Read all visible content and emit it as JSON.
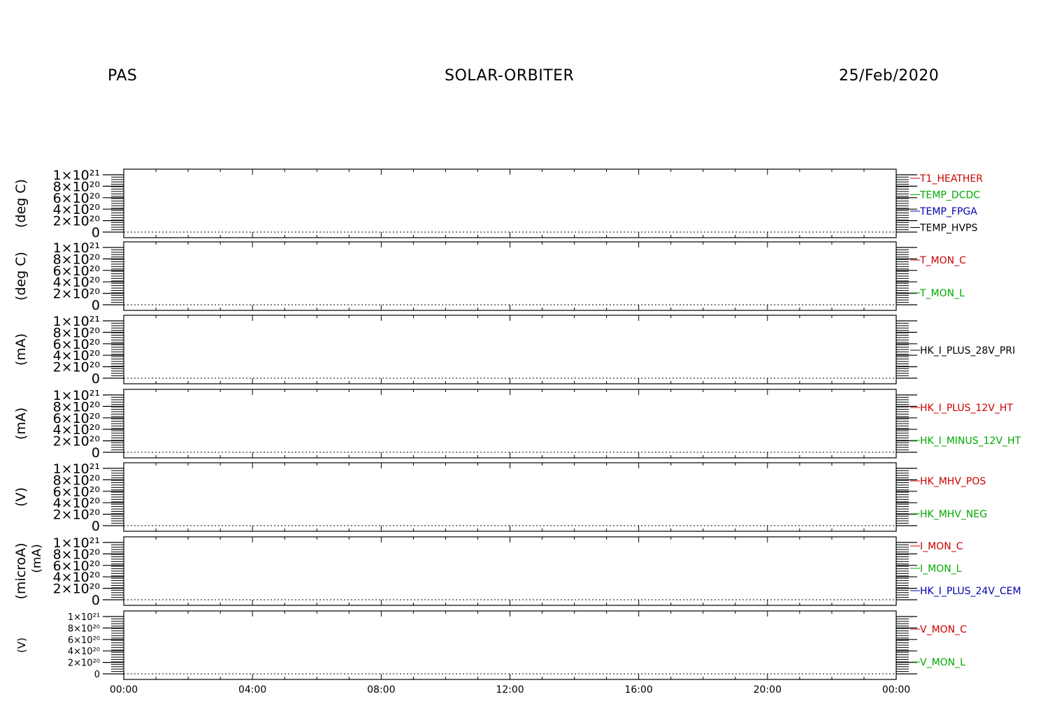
{
  "header": {
    "instrument": "PAS",
    "mission": "SOLAR-ORBITER",
    "date": "25/Feb/2020"
  },
  "colors": {
    "red": "#cc0000",
    "green": "#00aa00",
    "blue": "#0000aa",
    "black": "#000000"
  },
  "chart_data": {
    "type": "line",
    "x_axis": {
      "range": [
        "00:00",
        "24:00"
      ],
      "tick_labels": [
        "00:00",
        "04:00",
        "08:00",
        "12:00",
        "16:00",
        "20:00",
        "00:00"
      ]
    },
    "panels": [
      {
        "ylabel": "(deg C)",
        "ylim": [
          0,
          1e+21
        ],
        "tick_labels": [
          "1×10²¹",
          "8×10²⁰",
          "6×10²⁰",
          "4×10²⁰",
          "2×10²⁰",
          "0"
        ],
        "series": [
          {
            "name": "T1_HEATHER",
            "color": "#cc0000"
          },
          {
            "name": "TEMP_DCDC",
            "color": "#00aa00"
          },
          {
            "name": "TEMP_FPGA",
            "color": "#0000aa"
          },
          {
            "name": "TEMP_HVPS",
            "color": "#000000"
          }
        ]
      },
      {
        "ylabel": "(deg C)",
        "ylim": [
          0,
          1e+21
        ],
        "tick_labels": [
          "1×10²¹",
          "8×10²⁰",
          "6×10²⁰",
          "4×10²⁰",
          "2×10²⁰",
          "0"
        ],
        "series": [
          {
            "name": "T_MON_C",
            "color": "#cc0000"
          },
          {
            "name": "T_MON_L",
            "color": "#00aa00"
          }
        ]
      },
      {
        "ylabel": "(mA)",
        "ylim": [
          0,
          1e+21
        ],
        "tick_labels": [
          "1×10²¹",
          "8×10²⁰",
          "6×10²⁰",
          "4×10²⁰",
          "2×10²⁰",
          "0"
        ],
        "series": [
          {
            "name": "HK_I_PLUS_28V_PRI",
            "color": "#000000"
          }
        ]
      },
      {
        "ylabel": "(mA)",
        "ylim": [
          0,
          1e+21
        ],
        "tick_labels": [
          "1×10²¹",
          "8×10²⁰",
          "6×10²⁰",
          "4×10²⁰",
          "2×10²⁰",
          "0"
        ],
        "series": [
          {
            "name": "HK_I_PLUS_12V_HT",
            "color": "#cc0000"
          },
          {
            "name": "HK_I_MINUS_12V_HT",
            "color": "#00aa00"
          }
        ]
      },
      {
        "ylabel": "(V)",
        "ylim": [
          0,
          1e+21
        ],
        "tick_labels": [
          "1×10²¹",
          "8×10²⁰",
          "6×10²⁰",
          "4×10²⁰",
          "2×10²⁰",
          "0"
        ],
        "series": [
          {
            "name": "HK_MHV_POS",
            "color": "#cc0000"
          },
          {
            "name": "HK_MHV_NEG",
            "color": "#00aa00"
          }
        ]
      },
      {
        "ylabel": "(microA)",
        "ylabel2": "(mA)",
        "ylim": [
          0,
          1e+21
        ],
        "tick_labels": [
          "1×10²¹",
          "8×10²⁰",
          "6×10²⁰",
          "4×10²⁰",
          "2×10²⁰",
          "0"
        ],
        "series": [
          {
            "name": "I_MON_C",
            "color": "#cc0000"
          },
          {
            "name": "I_MON_L",
            "color": "#00aa00"
          },
          {
            "name": "HK_I_PLUS_24V_CEM",
            "color": "#0000aa"
          }
        ]
      },
      {
        "ylabel": "(V)",
        "ylim": [
          0,
          1e+21
        ],
        "tick_labels": [
          "1×10²¹",
          "8×10²⁰",
          "6×10²⁰",
          "4×10²⁰",
          "2×10²⁰",
          "0"
        ],
        "series": [
          {
            "name": "V_MON_C",
            "color": "#cc0000"
          },
          {
            "name": "V_MON_L",
            "color": "#00aa00"
          }
        ]
      }
    ]
  }
}
